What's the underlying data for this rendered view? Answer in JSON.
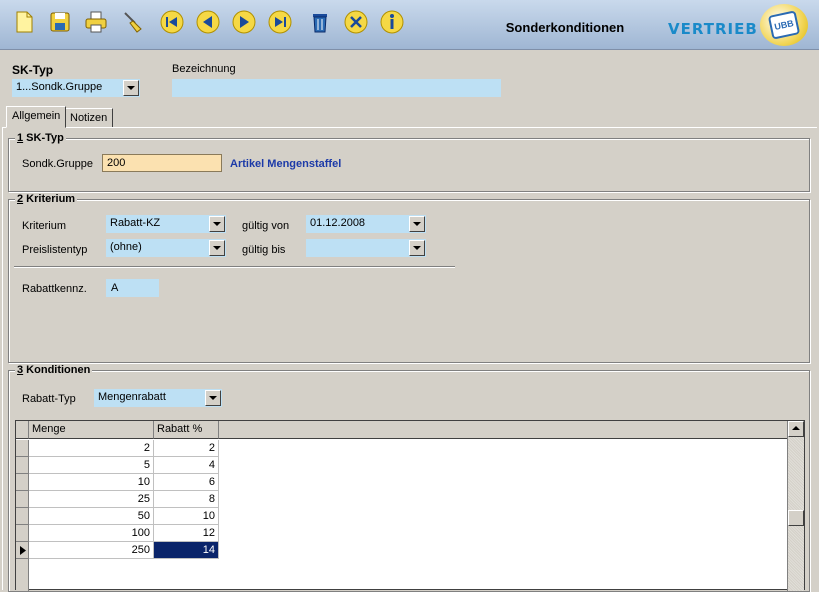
{
  "window": {
    "title": "Sonderkonditionen",
    "brand": "VERTRIEB",
    "logo_text": "UBB"
  },
  "toolbar": {
    "buttons": [
      {
        "icon": "new-document-icon"
      },
      {
        "icon": "save-icon"
      },
      {
        "icon": "print-icon"
      },
      {
        "icon": "broom-icon"
      },
      {
        "icon": "first-record-icon"
      },
      {
        "icon": "previous-record-icon"
      },
      {
        "icon": "next-record-icon"
      },
      {
        "icon": "last-record-icon"
      },
      {
        "icon": "trash-icon"
      },
      {
        "icon": "close-icon"
      },
      {
        "icon": "info-icon"
      }
    ]
  },
  "header": {
    "sk_typ_label": "SK-Typ",
    "sk_typ_value": "1...Sondk.Gruppe",
    "bezeichnung_label": "Bezeichnung",
    "bezeichnung_value": ""
  },
  "tabs": [
    {
      "label": "Allgemein",
      "active": true
    },
    {
      "label": "Notizen",
      "active": false
    }
  ],
  "section1": {
    "num": "1",
    "title": " SK-Typ",
    "sondk_label": "Sondk.Gruppe",
    "sondk_value": "200",
    "sondk_desc": "Artikel Mengenstaffel"
  },
  "section2": {
    "num": "2",
    "title": " Kriterium",
    "kriterium_label": "Kriterium",
    "kriterium_value": "Rabatt-KZ",
    "preisliste_label": "Preislistentyp",
    "preisliste_value": "(ohne)",
    "von_label": "gültig von",
    "von_value": "01.12.2008",
    "bis_label": "gültig bis",
    "bis_value": "",
    "rabattkennz_label": "Rabattkennz.",
    "rabattkennz_value": "A"
  },
  "section3": {
    "num": "3",
    "title": " Konditionen",
    "rabatt_typ_label": "Rabatt-Typ",
    "rabatt_typ_value": "Mengenrabatt"
  },
  "grid": {
    "columns": [
      "Menge",
      "Rabatt %"
    ],
    "rows": [
      {
        "menge": "2",
        "rabatt": "2"
      },
      {
        "menge": "5",
        "rabatt": "4"
      },
      {
        "menge": "10",
        "rabatt": "6"
      },
      {
        "menge": "25",
        "rabatt": "8"
      },
      {
        "menge": "50",
        "rabatt": "10"
      },
      {
        "menge": "100",
        "rabatt": "12"
      },
      {
        "menge": "250",
        "rabatt": "14"
      }
    ]
  },
  "colors": {
    "field_blue": "#bde0f4",
    "field_yellow": "#fbe1b0",
    "selection": "#0a246a",
    "link_blue": "#1c3aa8",
    "brand_blue": "#1a8ac9"
  }
}
